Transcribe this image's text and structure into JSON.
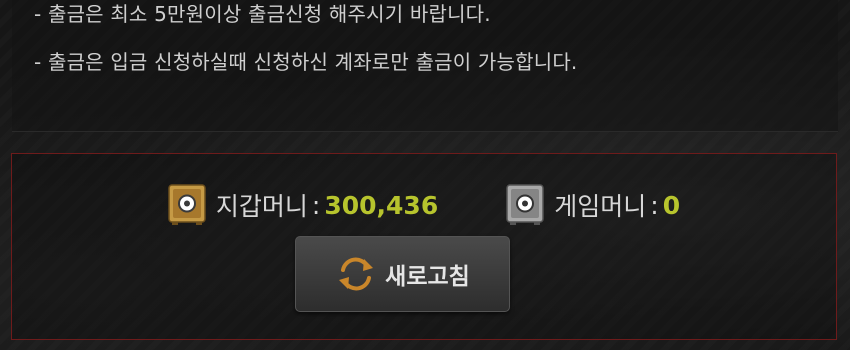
{
  "notice": {
    "lines": [
      "- 출금은 최소 5만원이상 출금신청 해주시기 바랍니다.",
      "- 출금은 입금 신청하실때 신청하신 계좌로만 출금이 가능합니다."
    ]
  },
  "wallet": {
    "wallet_money": {
      "label": "지갑머니",
      "separator": ":",
      "value": "300,436",
      "icon": "safe-gold-icon"
    },
    "game_money": {
      "label": "게임머니",
      "separator": ":",
      "value": "0",
      "icon": "safe-silver-icon"
    }
  },
  "refresh_button": {
    "label": "새로고침",
    "icon": "refresh-icon"
  },
  "colors": {
    "value_accent": "#b7c42d",
    "panel_border": "#6e1b1b",
    "refresh_icon": "#c9862a"
  }
}
